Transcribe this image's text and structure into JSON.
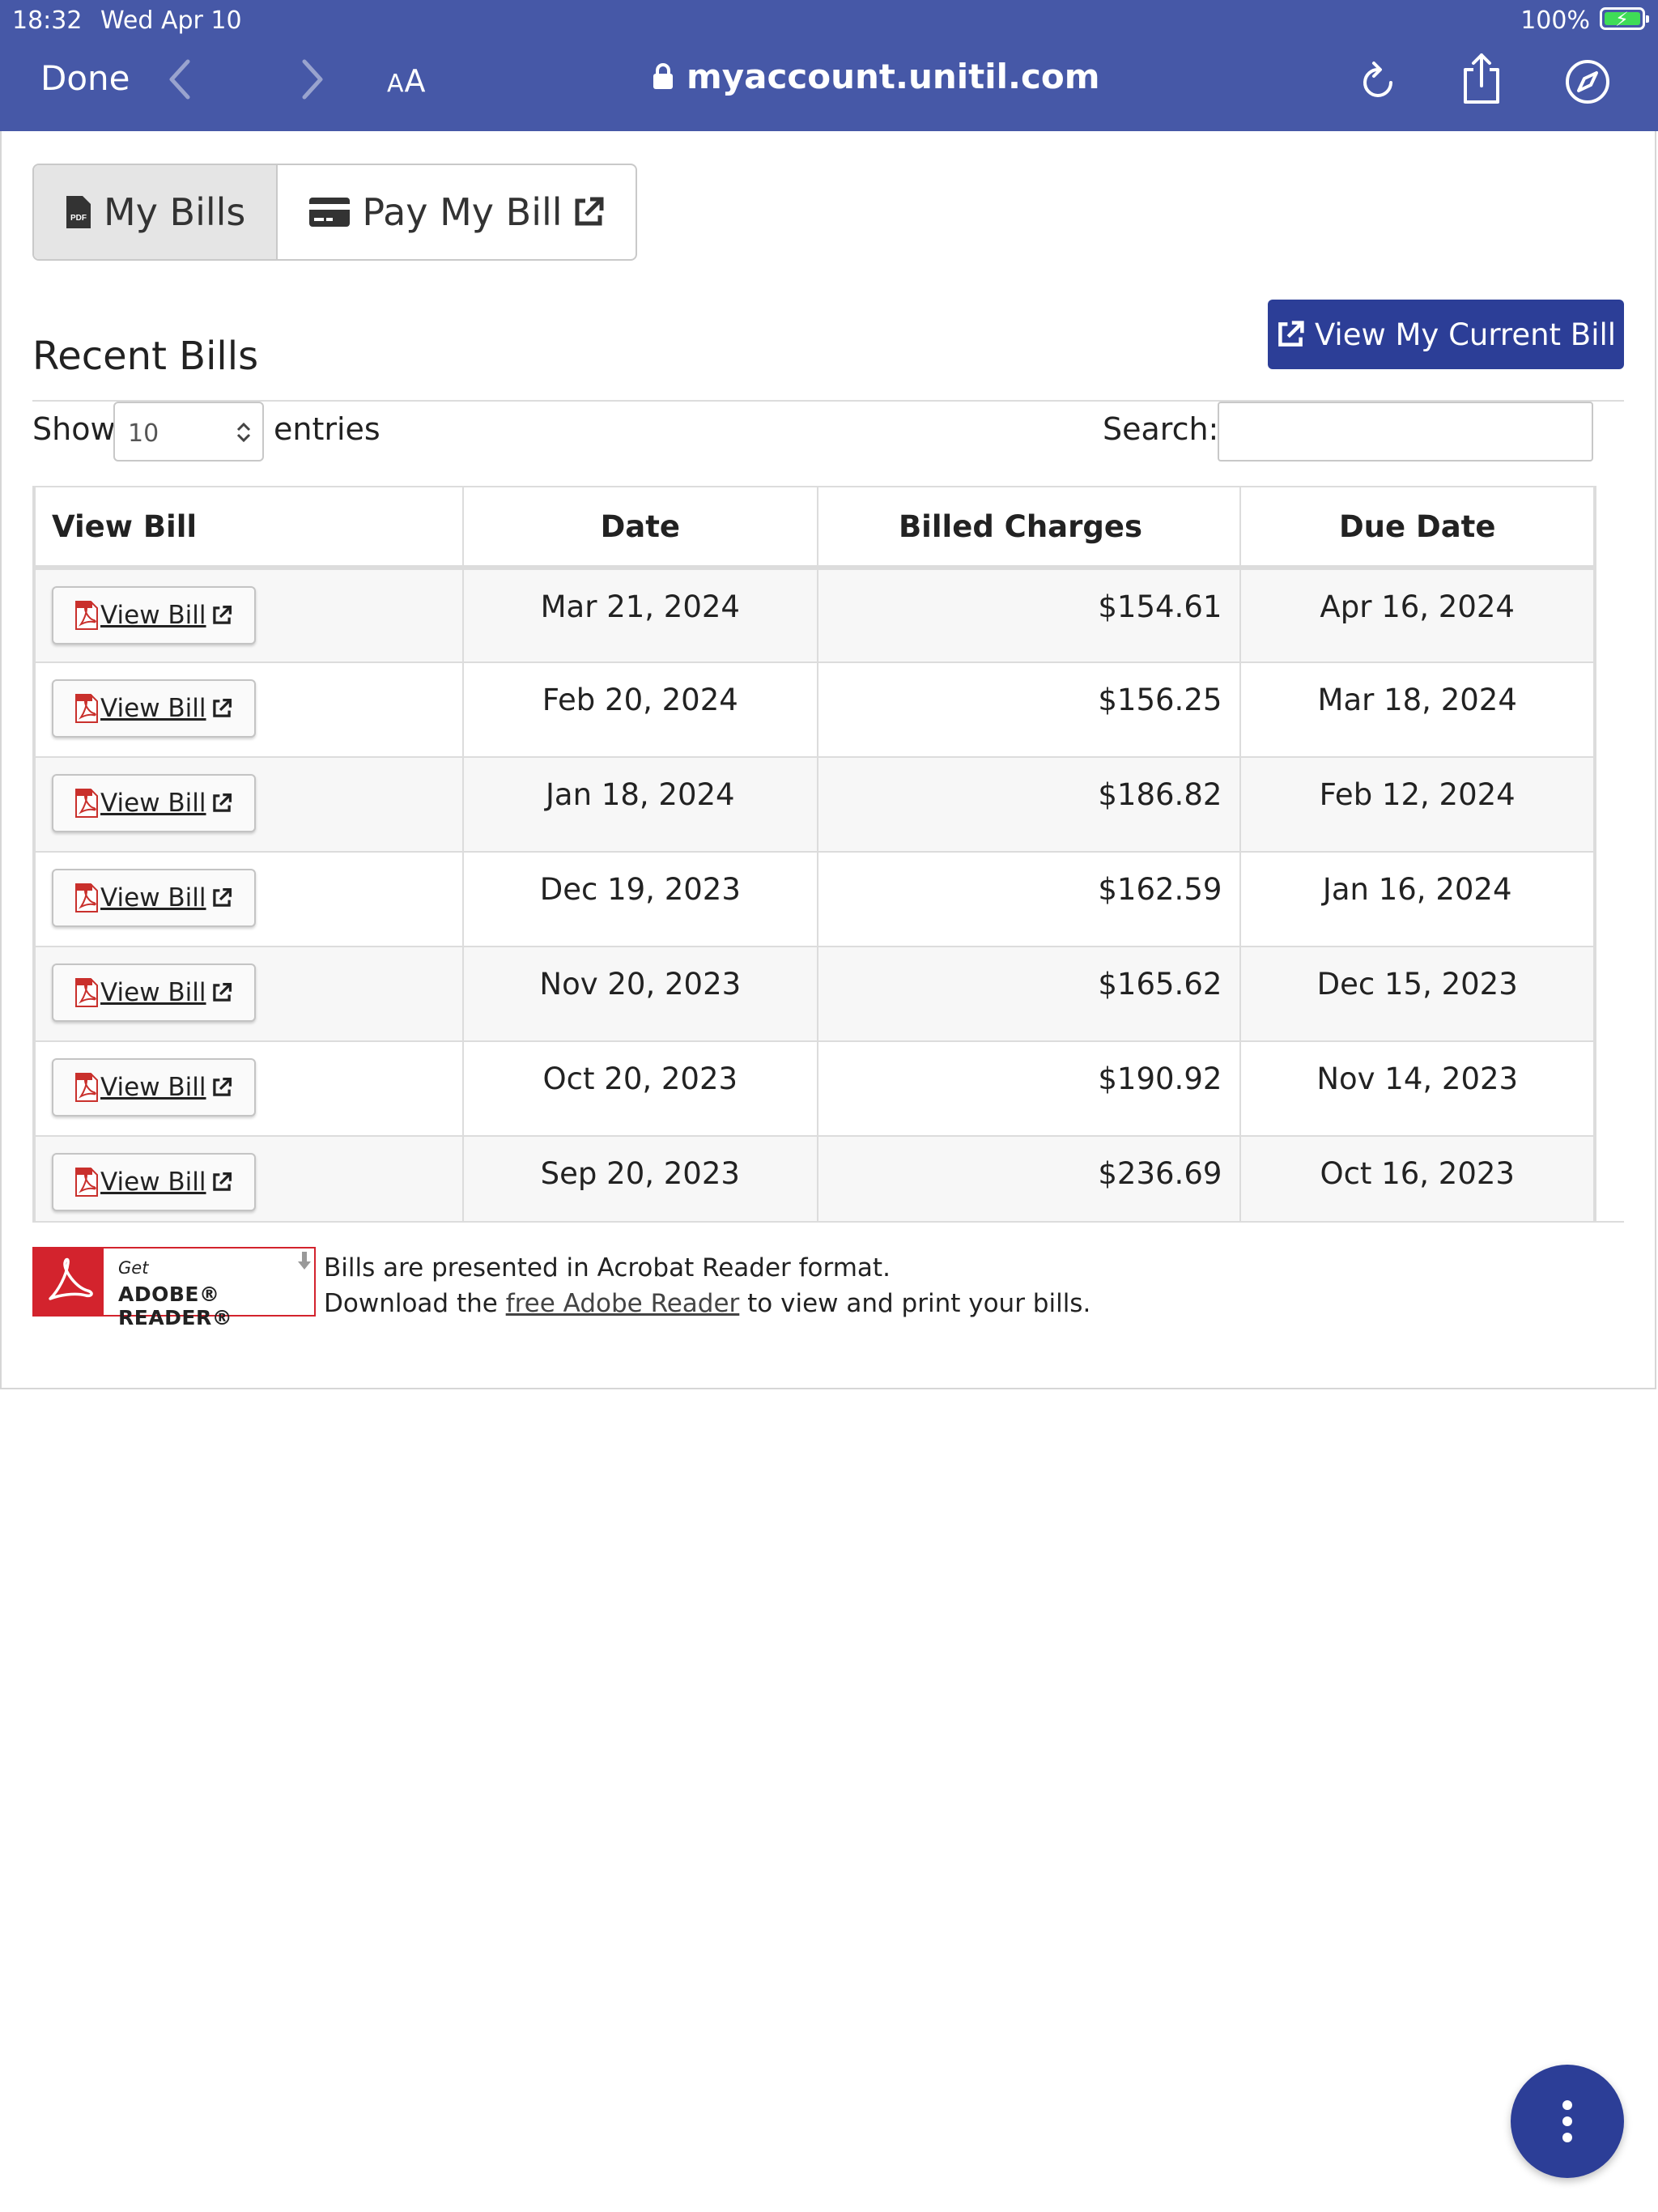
{
  "status_bar": {
    "time": "18:32",
    "date": "Wed Apr 10",
    "battery": "100%"
  },
  "browser": {
    "done_label": "Done",
    "text_size_label_small": "A",
    "text_size_label_large": "A",
    "url": "myaccount.unitil.com"
  },
  "tabs": [
    {
      "label": "My Bills",
      "icon": "pdf-file-icon",
      "active": true
    },
    {
      "label": "Pay My Bill",
      "icon": "credit-card-icon",
      "active": false
    }
  ],
  "section_title": "Recent Bills",
  "current_bill_button": "View My Current Bill",
  "length_control": {
    "show_label": "Show",
    "value": "10",
    "entries_label": "entries"
  },
  "search": {
    "label": "Search:",
    "value": ""
  },
  "table": {
    "headers": [
      "View Bill",
      "Date",
      "Billed Charges",
      "Due Date"
    ],
    "view_bill_label": "View Bill",
    "rows": [
      {
        "date": "Mar 21, 2024",
        "charges": "$154.61",
        "due": "Apr 16, 2024"
      },
      {
        "date": "Feb 20, 2024",
        "charges": "$156.25",
        "due": "Mar 18, 2024"
      },
      {
        "date": "Jan 18, 2024",
        "charges": "$186.82",
        "due": "Feb 12, 2024"
      },
      {
        "date": "Dec 19, 2023",
        "charges": "$162.59",
        "due": "Jan 16, 2024"
      },
      {
        "date": "Nov 20, 2023",
        "charges": "$165.62",
        "due": "Dec 15, 2023"
      },
      {
        "date": "Oct 20, 2023",
        "charges": "$190.92",
        "due": "Nov 14, 2023"
      },
      {
        "date": "Sep 20, 2023",
        "charges": "$236.69",
        "due": "Oct 16, 2023"
      }
    ]
  },
  "adobe": {
    "badge_get": "Get",
    "badge_reader": "ADOBE® READER®",
    "note_line1": "Bills are presented in Acrobat Reader format.",
    "note_line2_before": "Download the ",
    "note_link": "free Adobe Reader",
    "note_line2_after": " to view and print your bills."
  },
  "colors": {
    "chrome": "#4658a7",
    "primary": "#2c3e97",
    "adobe_red": "#d3232d",
    "battery_green": "#3fdc57"
  }
}
